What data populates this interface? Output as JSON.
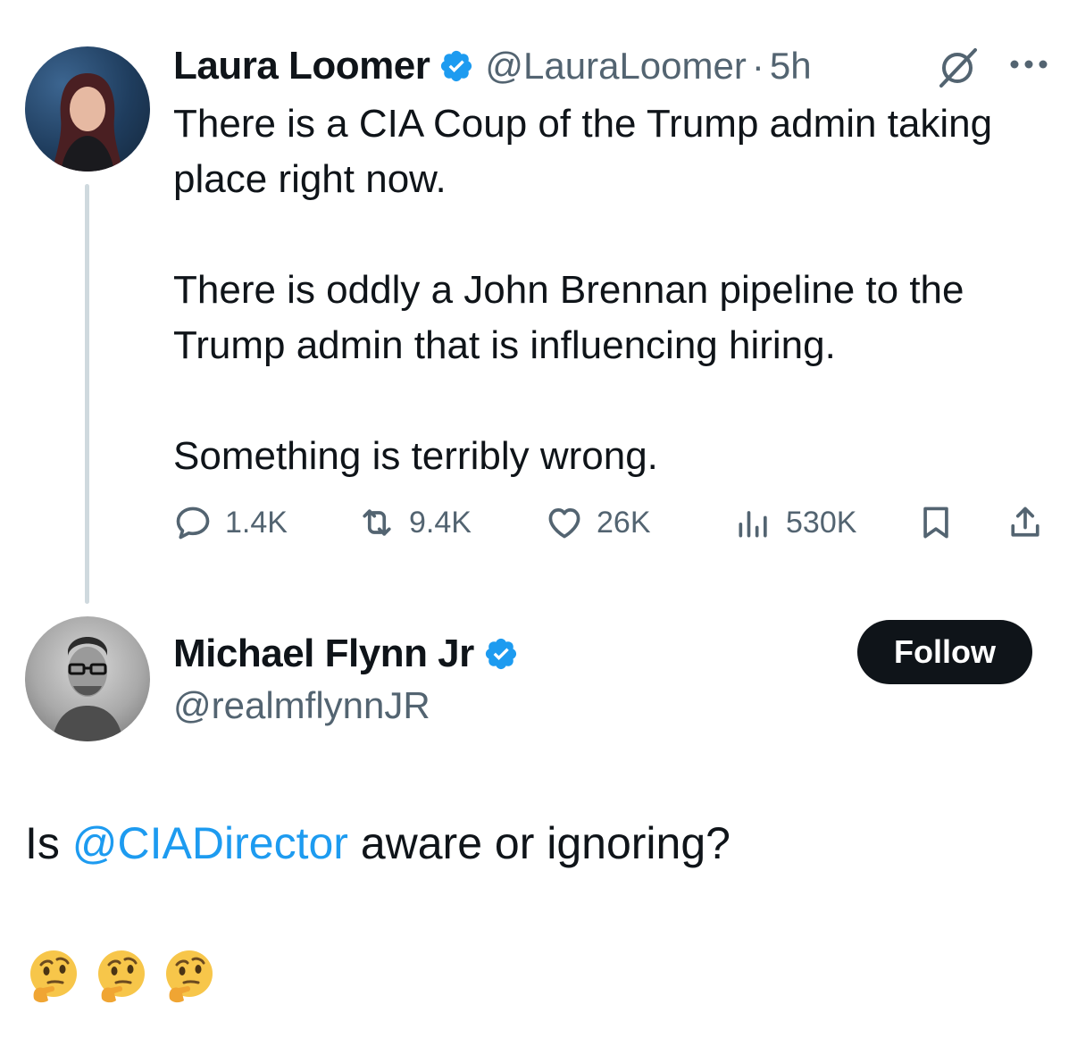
{
  "quoted_tweet": {
    "author": {
      "display_name": "Laura Loomer",
      "handle": "@LauraLoomer",
      "verified": true
    },
    "separator": "·",
    "time": "5h",
    "text_paragraphs": [
      "There is a CIA Coup of the Trump admin taking place right now.",
      "There is oddly a John Brennan pipeline to the Trump admin that is influencing hiring.",
      "Something is terribly wrong."
    ],
    "stats": {
      "replies": "1.4K",
      "reposts": "9.4K",
      "likes": "26K",
      "views": "530K"
    },
    "icons": [
      "grok-icon",
      "more-icon",
      "reply-icon",
      "repost-icon",
      "like-icon",
      "views-icon",
      "bookmark-icon",
      "share-icon"
    ]
  },
  "main_tweet": {
    "author": {
      "display_name": "Michael Flynn Jr",
      "handle": "@realmflynnJR",
      "verified": true
    },
    "follow_label": "Follow",
    "text_before": "Is ",
    "mention": "@CIADirector",
    "text_after": " aware or ignoring?",
    "emoji": [
      "🤔",
      "🤔",
      "🤔"
    ]
  },
  "colors": {
    "text": "#0f1419",
    "secondary": "#536471",
    "accent": "#1d9bf0",
    "thread_line": "#cfd9de",
    "follow_bg": "#0f1419"
  }
}
